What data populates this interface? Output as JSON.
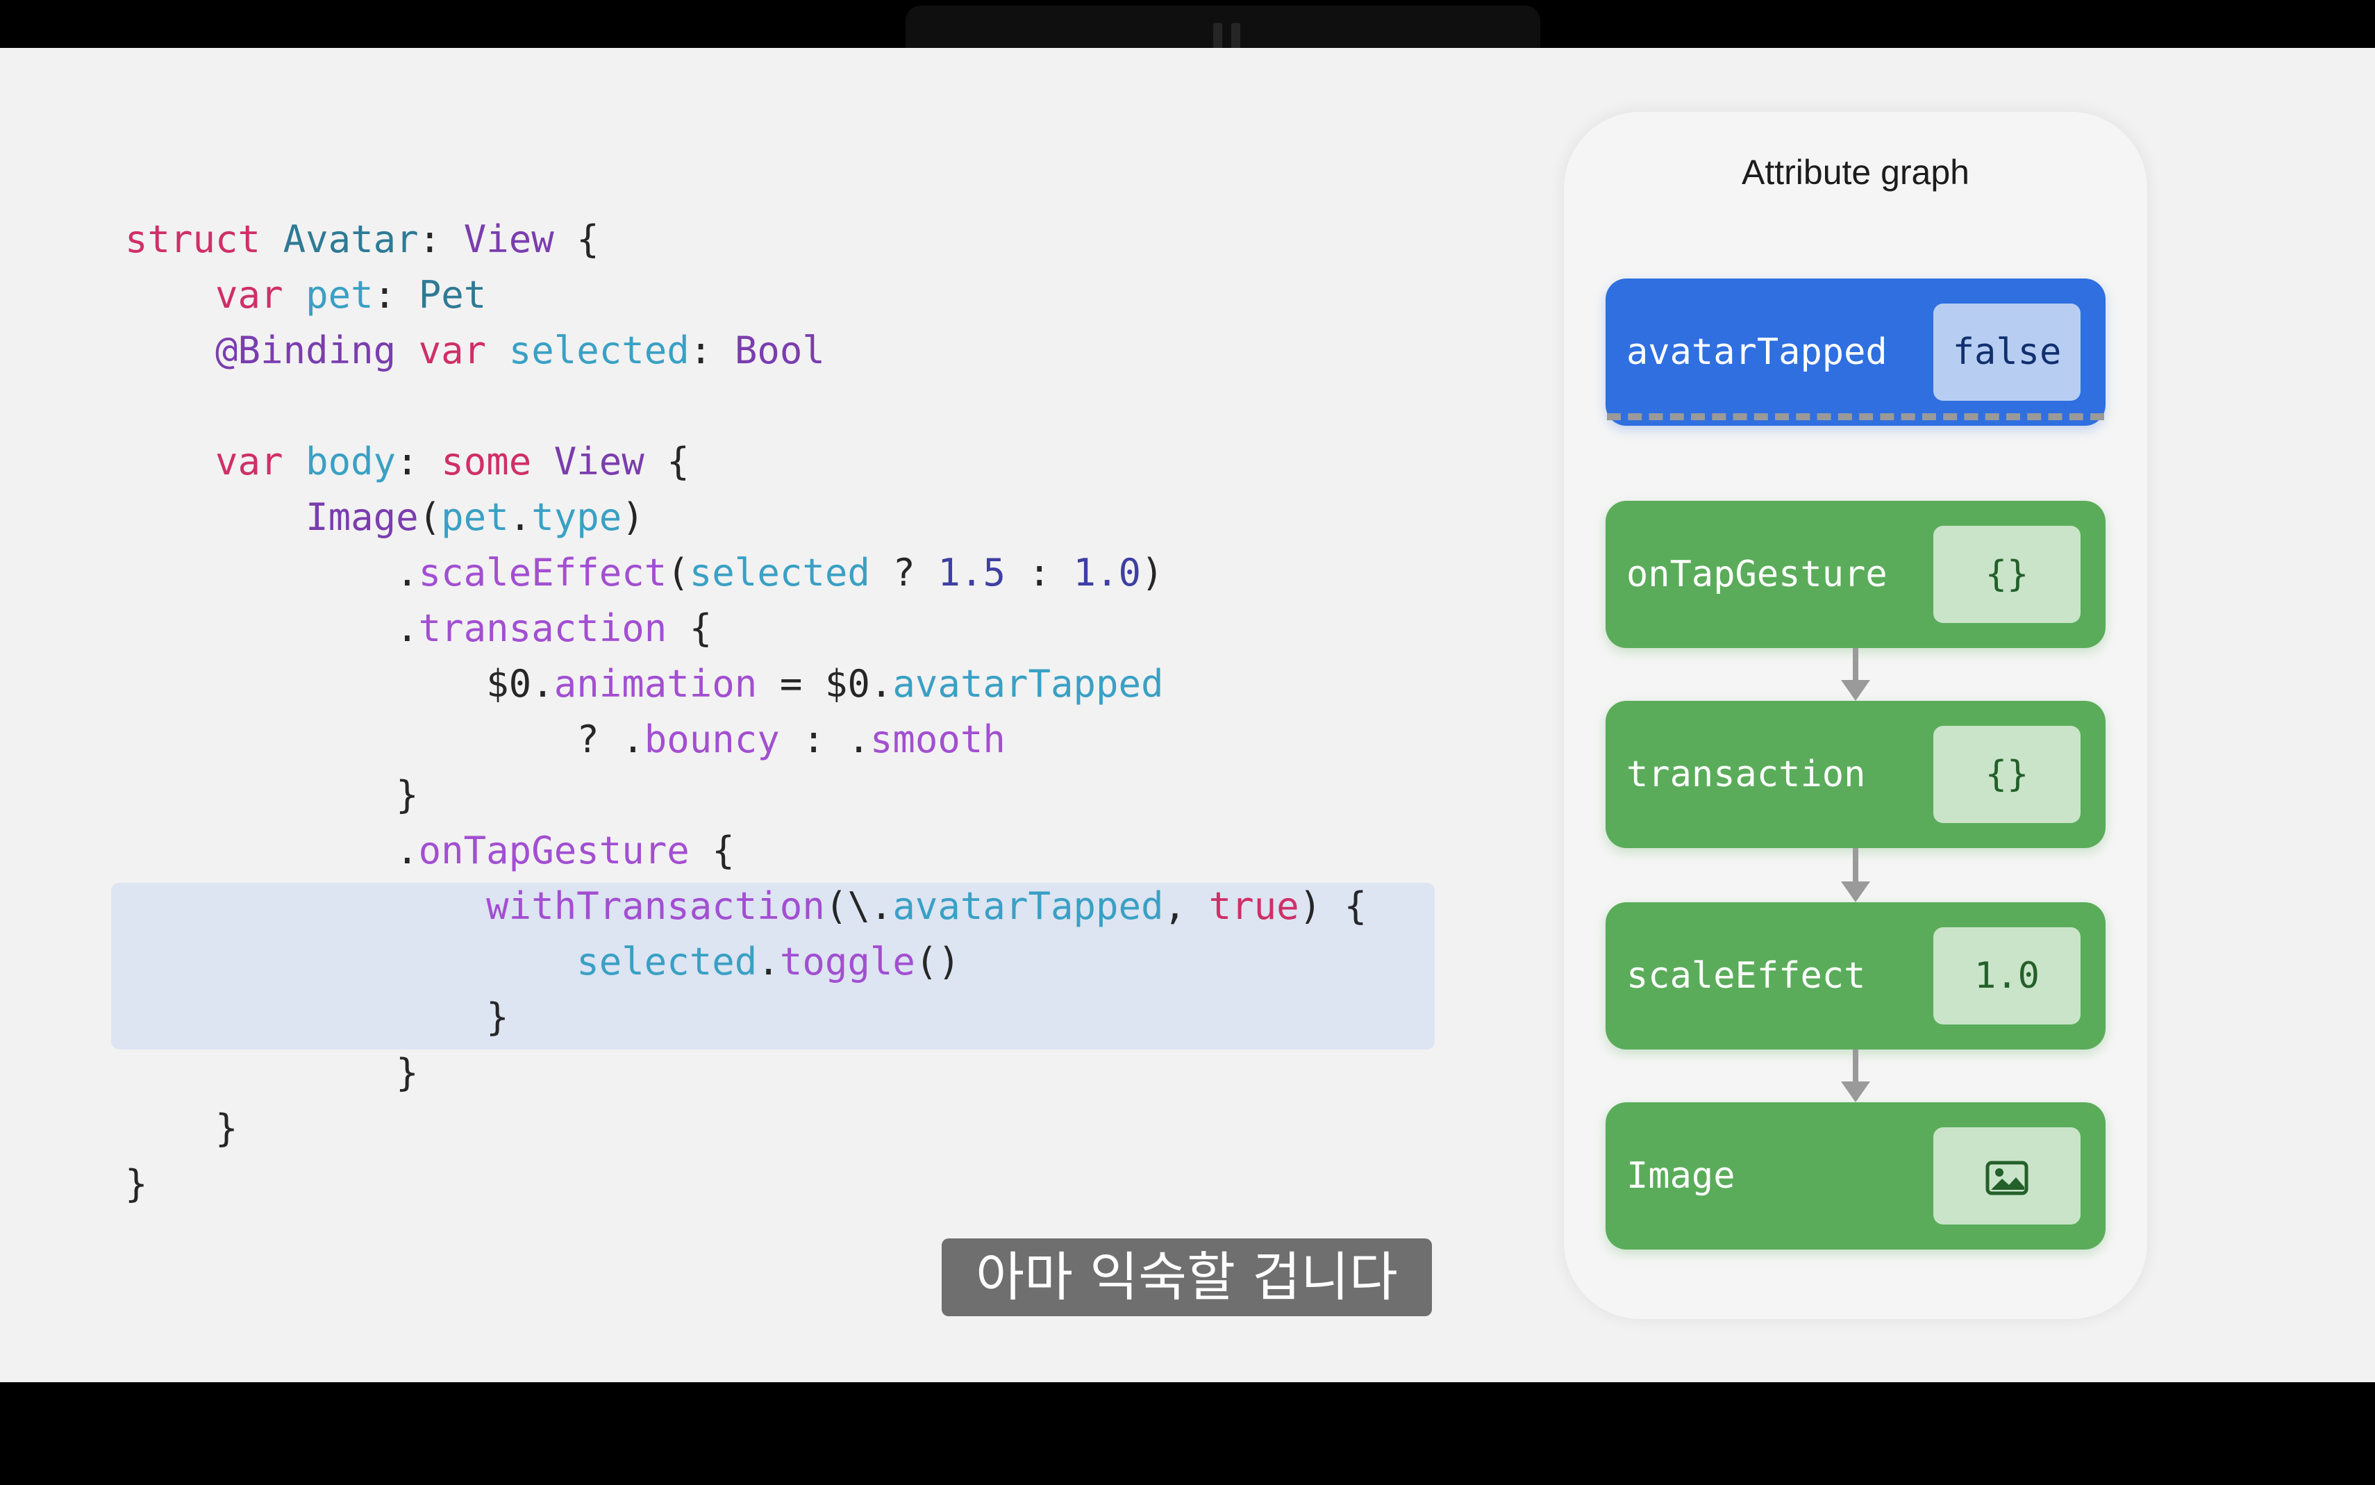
{
  "graph": {
    "title": "Attribute graph",
    "nodes": [
      {
        "label": "avatarTapped",
        "value": "false",
        "color": "#2f6fe0"
      },
      {
        "label": "onTapGesture",
        "value": "{}",
        "color": "#5aac5a"
      },
      {
        "label": "transaction",
        "value": "{}",
        "color": "#5aac5a"
      },
      {
        "label": "scaleEffect",
        "value": "1.0",
        "color": "#5aac5a"
      },
      {
        "label": "Image",
        "value_icon": "image-icon",
        "color": "#5aac5a"
      }
    ]
  },
  "subtitle": "아마 익숙할 겁니다",
  "code_lines": [
    [
      [
        "kw",
        "struct"
      ],
      [
        "pl",
        " "
      ],
      [
        "ty",
        "Avatar"
      ],
      [
        "pl",
        ": "
      ],
      [
        "tp",
        "View"
      ],
      [
        "pl",
        " {"
      ]
    ],
    [
      [
        "pl",
        "    "
      ],
      [
        "kw",
        "var"
      ],
      [
        "pl",
        " "
      ],
      [
        "pr",
        "pet"
      ],
      [
        "pl",
        ": "
      ],
      [
        "ty",
        "Pet"
      ]
    ],
    [
      [
        "pl",
        "    "
      ],
      [
        "tp",
        "@Binding"
      ],
      [
        "pl",
        " "
      ],
      [
        "kw",
        "var"
      ],
      [
        "pl",
        " "
      ],
      [
        "pr",
        "selected"
      ],
      [
        "pl",
        ": "
      ],
      [
        "tp",
        "Bool"
      ]
    ],
    [
      [
        "pl",
        ""
      ]
    ],
    [
      [
        "pl",
        "    "
      ],
      [
        "kw",
        "var"
      ],
      [
        "pl",
        " "
      ],
      [
        "pr",
        "body"
      ],
      [
        "pl",
        ": "
      ],
      [
        "kw",
        "some"
      ],
      [
        "pl",
        " "
      ],
      [
        "tp",
        "View"
      ],
      [
        "pl",
        " {"
      ]
    ],
    [
      [
        "pl",
        "        "
      ],
      [
        "tp",
        "Image"
      ],
      [
        "pl",
        "("
      ],
      [
        "pr",
        "pet"
      ],
      [
        "pl",
        "."
      ],
      [
        "pr",
        "type"
      ],
      [
        "pl",
        ")"
      ]
    ],
    [
      [
        "pl",
        "            ."
      ],
      [
        "mt",
        "scaleEffect"
      ],
      [
        "pl",
        "("
      ],
      [
        "pr",
        "selected"
      ],
      [
        "pl",
        " ? "
      ],
      [
        "nm",
        "1.5"
      ],
      [
        "pl",
        " : "
      ],
      [
        "nm",
        "1.0"
      ],
      [
        "pl",
        ")"
      ]
    ],
    [
      [
        "pl",
        "            ."
      ],
      [
        "mt",
        "transaction"
      ],
      [
        "pl",
        " {"
      ]
    ],
    [
      [
        "pl",
        "                $0."
      ],
      [
        "mt",
        "animation"
      ],
      [
        "pl",
        " = $0."
      ],
      [
        "pr",
        "avatarTapped"
      ]
    ],
    [
      [
        "pl",
        "                    ? ."
      ],
      [
        "mt",
        "bouncy"
      ],
      [
        "pl",
        " : ."
      ],
      [
        "mt",
        "smooth"
      ]
    ],
    [
      [
        "pl",
        "            }"
      ]
    ],
    [
      [
        "pl",
        "            ."
      ],
      [
        "mt",
        "onTapGesture"
      ],
      [
        "pl",
        " {"
      ]
    ],
    [
      [
        "pl",
        "                "
      ],
      [
        "mt",
        "withTransaction"
      ],
      [
        "pl",
        "(\\."
      ],
      [
        "pr",
        "avatarTapped"
      ],
      [
        "pl",
        ", "
      ],
      [
        "kw",
        "true"
      ],
      [
        "pl",
        ") {"
      ]
    ],
    [
      [
        "pl",
        "                    "
      ],
      [
        "pr",
        "selected"
      ],
      [
        "pl",
        "."
      ],
      [
        "mt",
        "toggle"
      ],
      [
        "pl",
        "()"
      ]
    ],
    [
      [
        "pl",
        "                }"
      ]
    ],
    [
      [
        "pl",
        "            }"
      ]
    ],
    [
      [
        "pl",
        "    }"
      ]
    ],
    [
      [
        "pl",
        "}"
      ]
    ]
  ]
}
